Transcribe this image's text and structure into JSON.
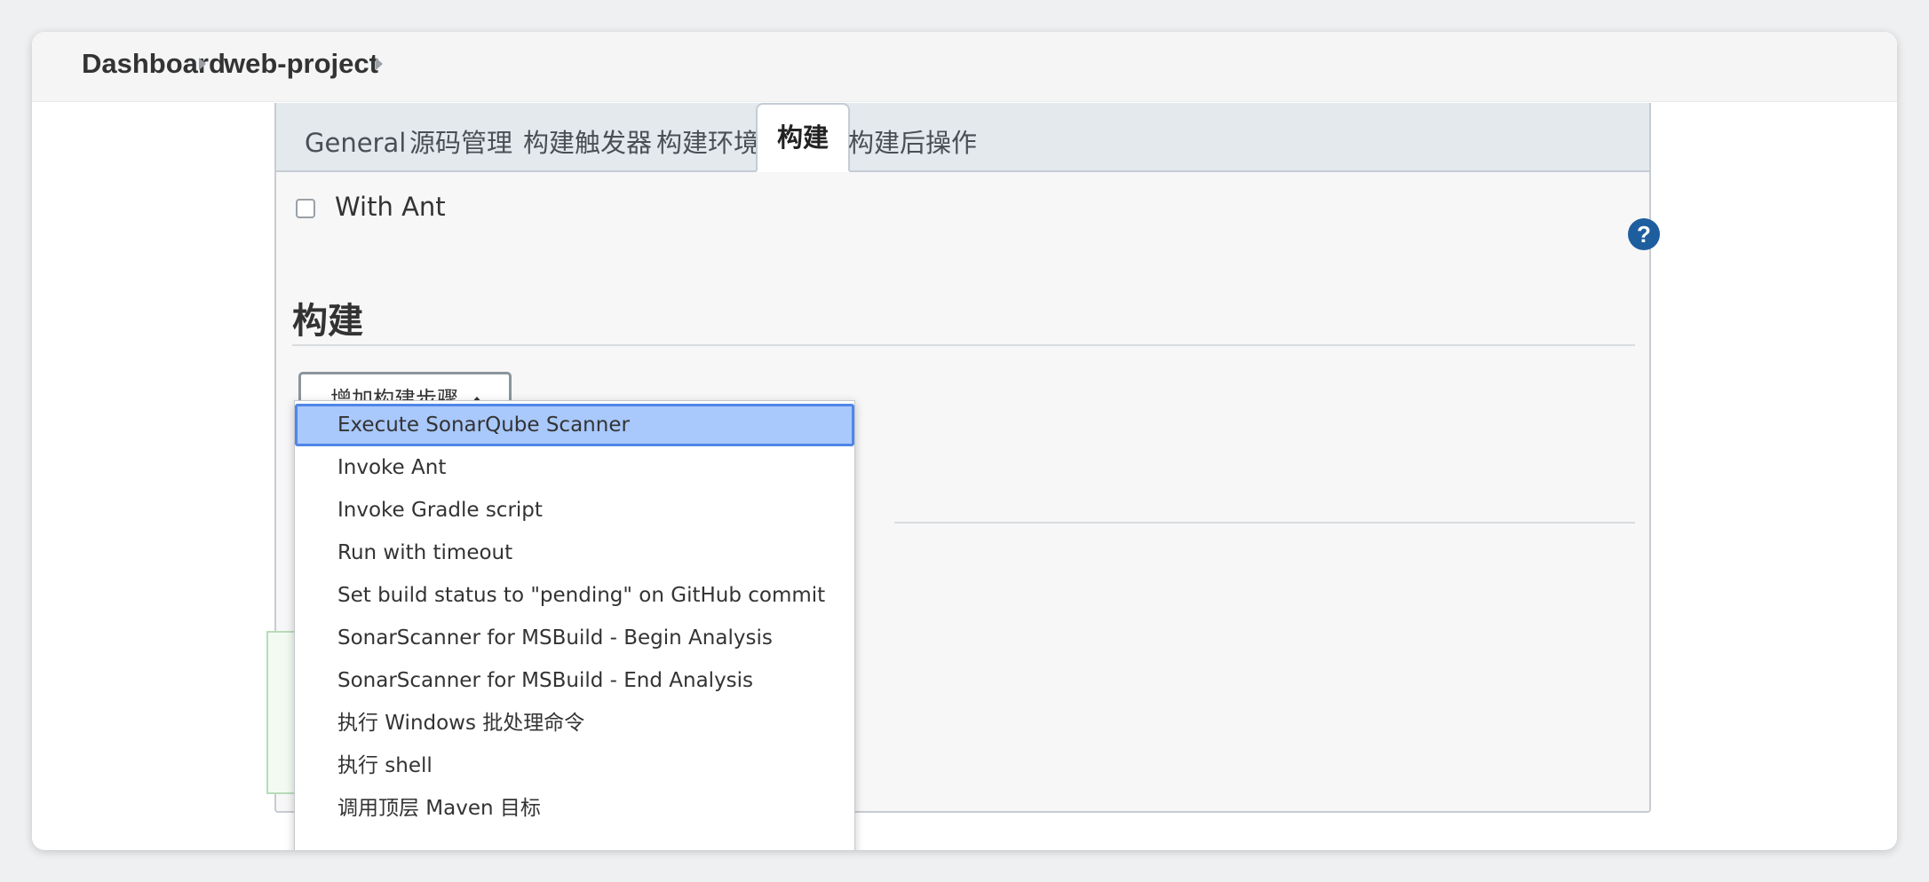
{
  "breadcrumb": {
    "items": [
      "Dashboard",
      "web-project"
    ]
  },
  "tabs": [
    {
      "label": "General",
      "active": false
    },
    {
      "label": "源码管理",
      "active": false
    },
    {
      "label": "构建触发器",
      "active": false
    },
    {
      "label": "构建环境",
      "active": false
    },
    {
      "label": "构建",
      "active": true
    },
    {
      "label": "构建后操作",
      "active": false
    }
  ],
  "with_ant": {
    "label": "With Ant",
    "checked": false
  },
  "help_icon": "?",
  "section": {
    "title": "构建"
  },
  "add_step_button": {
    "label": "增加构建步骤"
  },
  "dropdown": {
    "selected_index": 0,
    "items": [
      "Execute SonarQube Scanner",
      "Invoke Ant",
      "Invoke Gradle script",
      "Run with timeout",
      "Set build status to \"pending\" on GitHub commit",
      "SonarScanner for MSBuild - Begin Analysis",
      "SonarScanner for MSBuild - End Analysis",
      "执行 Windows 批处理命令",
      "执行 shell",
      "调用顶层 Maven 目标"
    ]
  },
  "colors": {
    "selected_bg": "#a9c8fb",
    "selected_border": "#4f86e8",
    "help_icon": "#1e5e9e"
  }
}
